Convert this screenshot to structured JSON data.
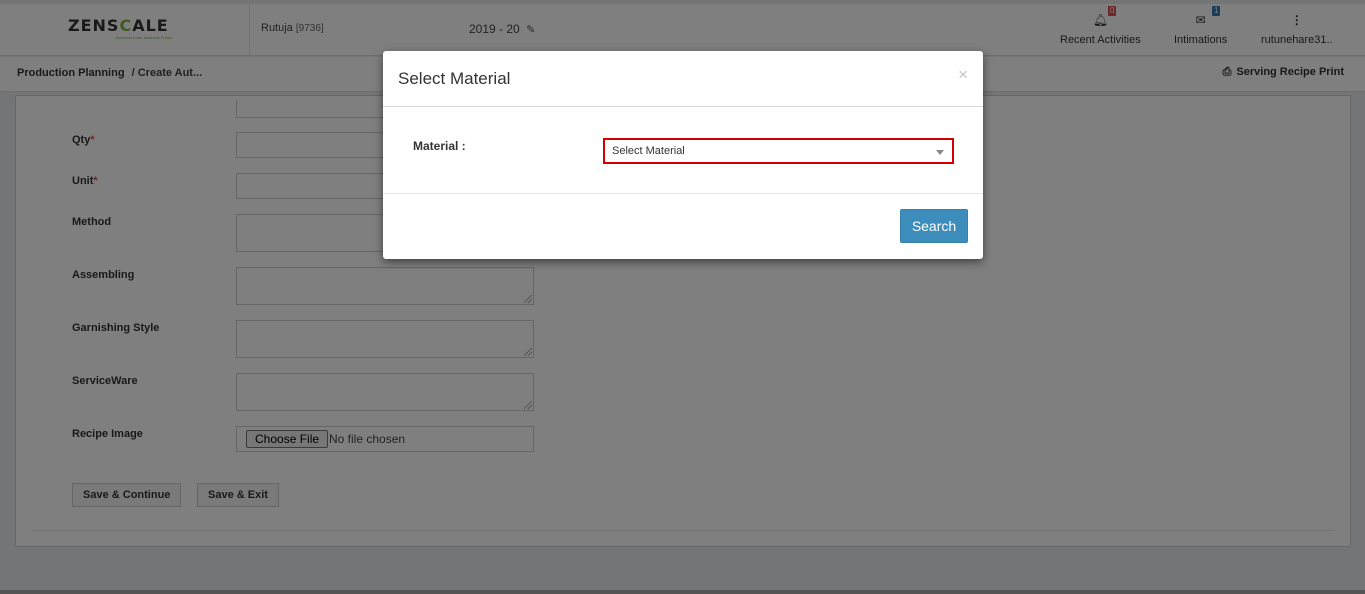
{
  "header": {
    "logo_prefix": "ZENS",
    "logo_mid": "C",
    "logo_suffix": "ALE",
    "logo_tagline": "Business tools, business Future",
    "user_name": "Rutuja",
    "user_code": "[9736]",
    "fiscal_year": "2019 - 20",
    "recent_activities": {
      "label": "Recent Activities",
      "badge": "0",
      "icon": "bell-icon"
    },
    "intimations": {
      "label": "Intimations",
      "badge": "1",
      "icon": "envelope-icon"
    },
    "account": {
      "label": "rutunehare31..",
      "icon": "vertical-dots-icon"
    }
  },
  "breadcrumb": {
    "root": "Production Planning",
    "current": "/ Create Aut...",
    "print_label": "Serving Recipe Print"
  },
  "form": {
    "qty_label": "Qty",
    "unit_label": "Unit",
    "method_label": "Method",
    "assembling_label": "Assembling",
    "garnishing_label": "Garnishing Style",
    "serviceware_label": "ServiceWare",
    "recipe_image_label": "Recipe Image",
    "choose_file": "Choose File",
    "no_file": "No file chosen",
    "save_continue": "Save & Continue",
    "save_exit": "Save & Exit",
    "required_mark": "*"
  },
  "modal": {
    "title": "Select Material",
    "close": "×",
    "material_label": "Material :",
    "select_value": "Select Material",
    "search_button": "Search"
  }
}
